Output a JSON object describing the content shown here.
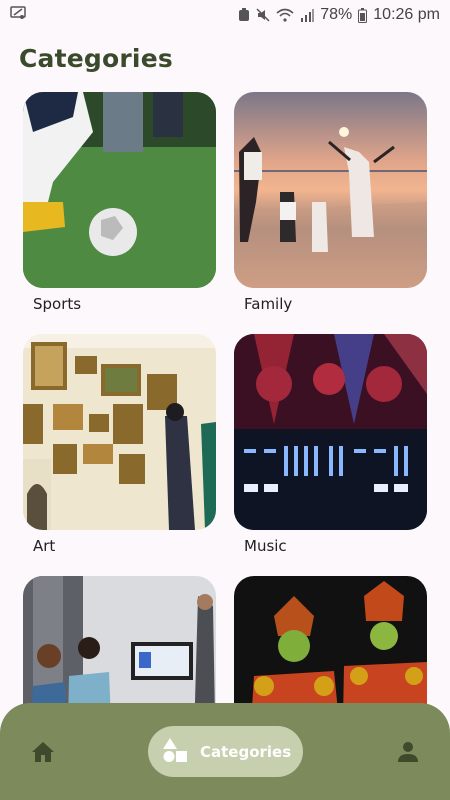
{
  "status_bar": {
    "battery": "78%",
    "time": "10:26 pm"
  },
  "page": {
    "title": "Categories"
  },
  "categories": [
    {
      "label": "Sports"
    },
    {
      "label": "Family"
    },
    {
      "label": "Art"
    },
    {
      "label": "Music"
    },
    {
      "label": ""
    },
    {
      "label": ""
    }
  ],
  "bottom_nav": {
    "items": [
      {
        "icon": "home-icon",
        "label": ""
      },
      {
        "icon": "categories-icon",
        "label": "Categories",
        "active": true
      },
      {
        "icon": "profile-icon",
        "label": ""
      }
    ]
  },
  "colors": {
    "title": "#3a4a2b",
    "nav_background": "#7d8a5c",
    "nav_active_pill": "#c6cfae",
    "nav_icon": "#3f4a2c"
  }
}
